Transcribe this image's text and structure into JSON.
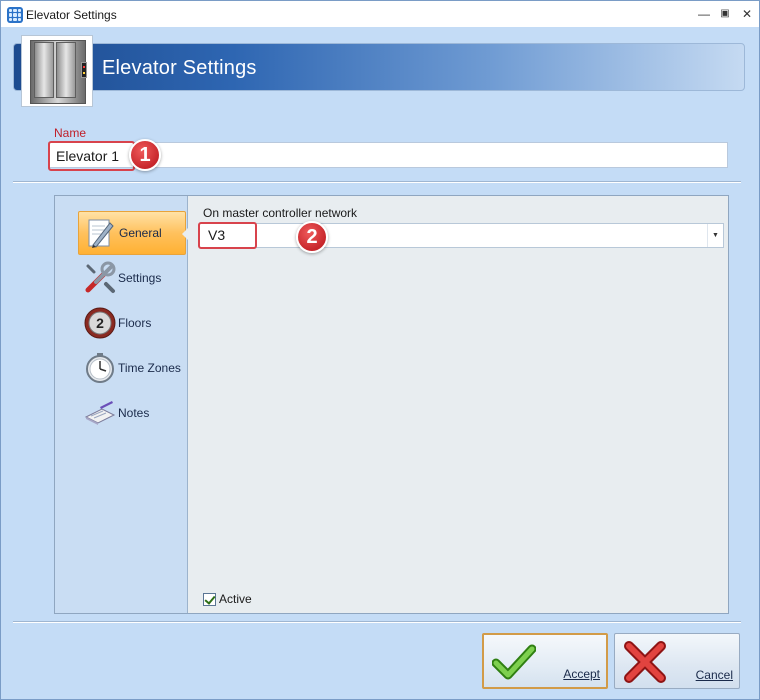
{
  "window": {
    "title": "Elevator Settings",
    "controls": {
      "minimize": "—",
      "maximize": "▣",
      "close": "✕"
    }
  },
  "header": {
    "title": "Elevator Settings",
    "icon": "elevator-icon"
  },
  "name_field": {
    "label": "Name",
    "value": "Elevator 1"
  },
  "annotations": {
    "badge1": "1",
    "badge2": "2"
  },
  "nav": {
    "items": [
      {
        "label": "General",
        "icon": "pencil-document-icon",
        "selected": true
      },
      {
        "label": "Settings",
        "icon": "tools-icon",
        "selected": false
      },
      {
        "label": "Floors",
        "icon": "floor-number-icon",
        "selected": false
      },
      {
        "label": "Time Zones",
        "icon": "clock-icon",
        "selected": false
      },
      {
        "label": "Notes",
        "icon": "notes-icon",
        "selected": false
      }
    ]
  },
  "general": {
    "network_label": "On master controller network",
    "network_value": "V3",
    "floors_badge": "2",
    "active_label": "Active",
    "active_checked": true
  },
  "buttons": {
    "accept": "Accept",
    "cancel": "Cancel"
  },
  "colors": {
    "window_bg": "#c4dcf6",
    "banner_start": "#1d4b8f",
    "highlight": "#d8434c",
    "selected_nav": "#ffc15d"
  }
}
